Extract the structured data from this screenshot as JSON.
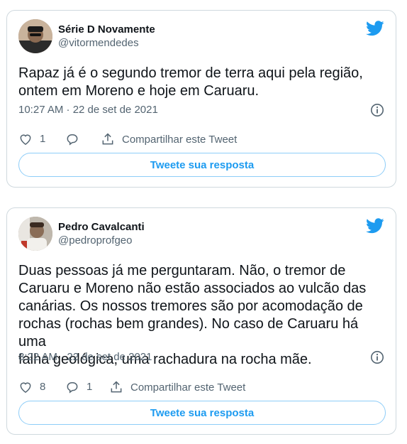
{
  "tweets": [
    {
      "author_name": "Série D Novamente",
      "author_handle": "@vitormendedes",
      "text": "Rapaz já é o segundo tremor de terra aqui pela região,\nontem em Moreno e hoje em Caruaru.",
      "timestamp": "10:27 AM · 22 de set de 2021",
      "likes": "1",
      "replies": "",
      "share_label": "Compartilhar este Tweet",
      "reply_button_label": "Tweete sua resposta",
      "icons": [
        "twitter-bird-icon",
        "info-icon",
        "heart-icon",
        "reply-icon",
        "share-icon"
      ]
    },
    {
      "author_name": "Pedro Cavalcanti",
      "author_handle": "@pedroprofgeo",
      "text": "Duas pessoas já me perguntaram. Não, o tremor de\nCaruaru e Moreno não estão associados ao vulcão das\ncanárias. Os nossos tremores são por acomodação de\nrochas (rochas bem grandes). No caso de Caruaru há uma\nfalha geológica, uma rachadura na rocha mãe.",
      "timestamp": "8:22 AM · 22 de set de 2021",
      "likes": "8",
      "replies": "1",
      "share_label": "Compartilhar este Tweet",
      "reply_button_label": "Tweete sua resposta",
      "icons": [
        "twitter-bird-icon",
        "info-icon",
        "heart-icon",
        "reply-icon",
        "share-icon"
      ]
    }
  ],
  "colors": {
    "accent": "#1d9bf0",
    "text": "#0f1419",
    "muted": "#536471",
    "border": "#cfd9de"
  }
}
